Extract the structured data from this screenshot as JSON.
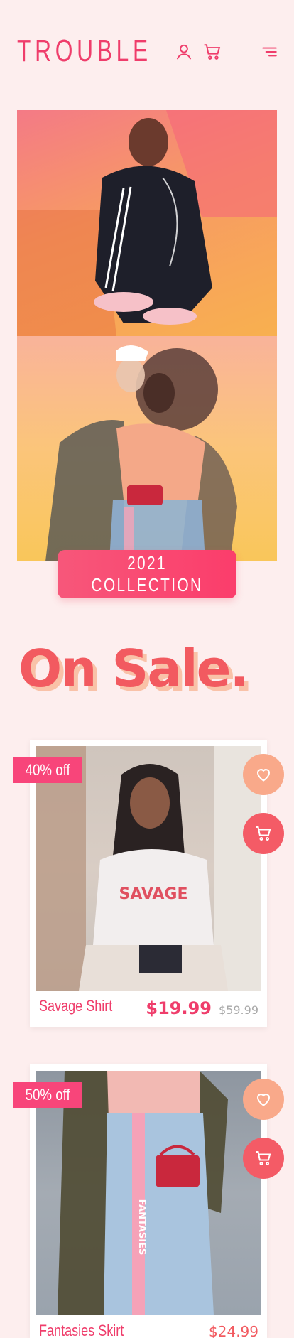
{
  "header": {
    "brand": "TROUBLE",
    "icons": [
      "user-icon",
      "cart-icon",
      "menu-icon"
    ]
  },
  "hero": {
    "cta_label": "2021 COLLECTION"
  },
  "sale": {
    "title": "On Sale."
  },
  "products": [
    {
      "name": "Savage Shirt",
      "badge": "40% off",
      "price": "$19.99",
      "old_price": "$59.99",
      "image_print": "SAVAGE"
    },
    {
      "name": "Fantasies Skirt",
      "badge": "50% off",
      "price": "$24.99",
      "image_print": "FANTASIES"
    }
  ],
  "colors": {
    "brand": "#ef3d6b",
    "background": "#fdeeee",
    "fav_button": "#f9a98a",
    "cart_button": "#f45b66",
    "sale_title": "#f25a60"
  }
}
